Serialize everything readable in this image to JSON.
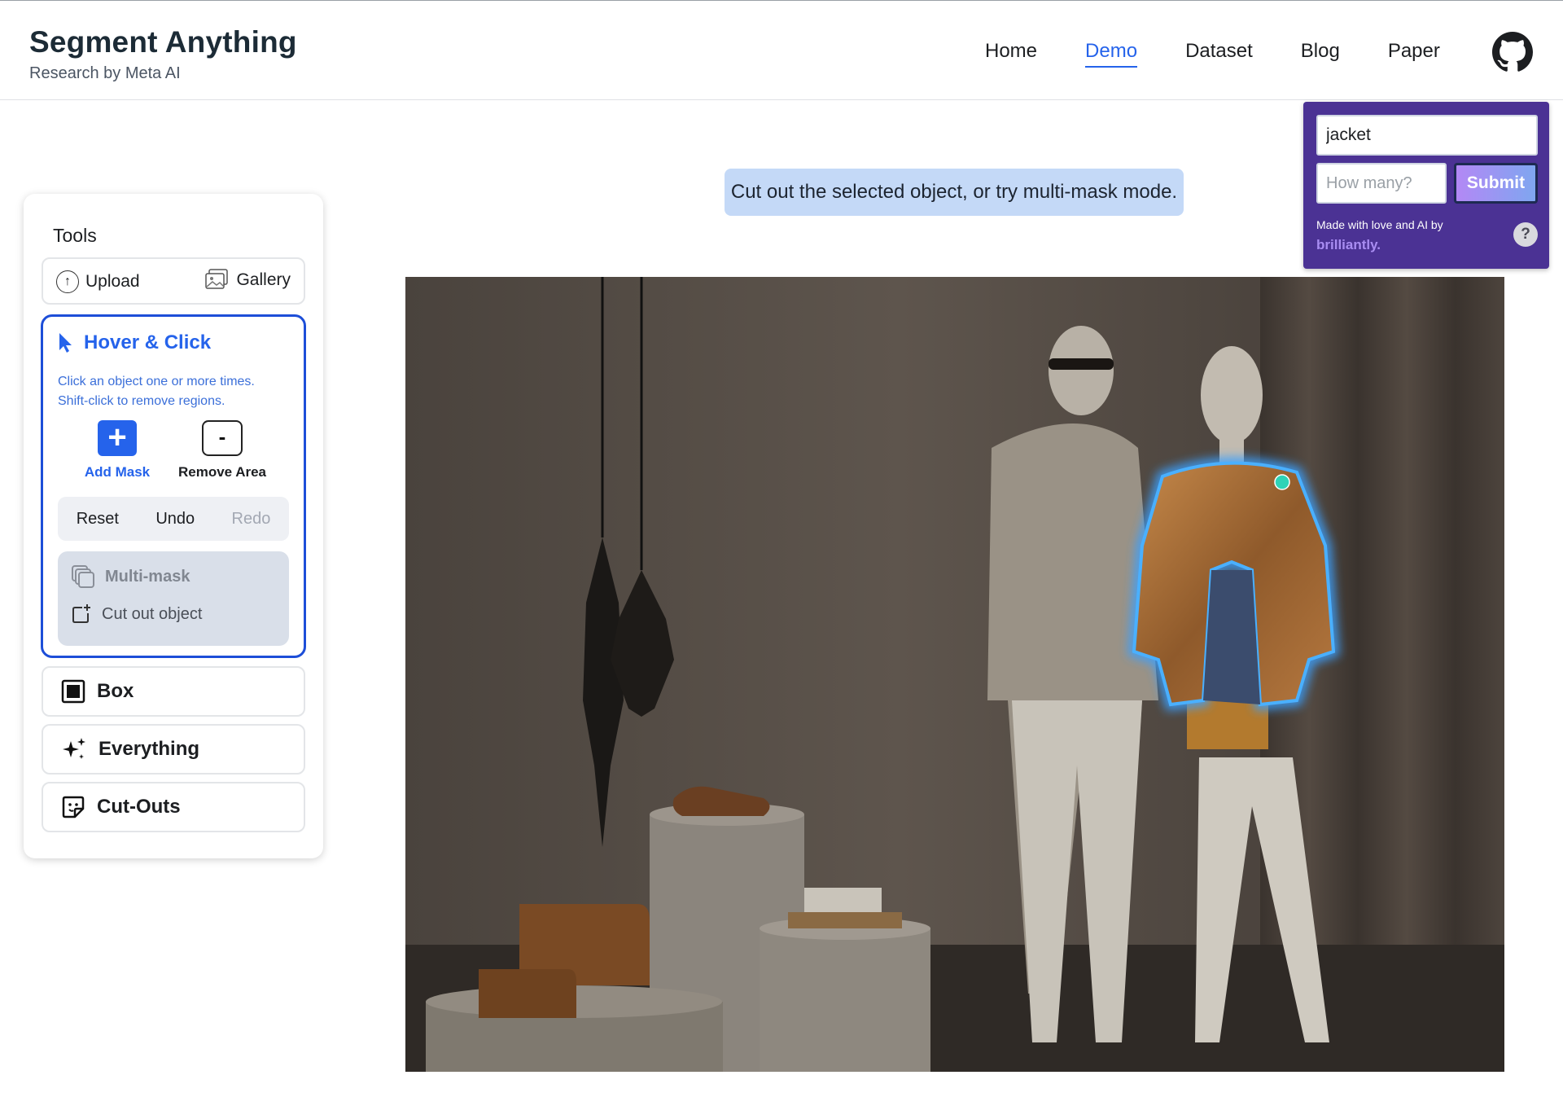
{
  "header": {
    "title": "Segment Anything",
    "subtitle": "Research by Meta AI",
    "nav": [
      {
        "label": "Home",
        "active": false
      },
      {
        "label": "Demo",
        "active": true
      },
      {
        "label": "Dataset",
        "active": false
      },
      {
        "label": "Blog",
        "active": false
      },
      {
        "label": "Paper",
        "active": false
      }
    ],
    "github_icon": "github-icon"
  },
  "ai_panel": {
    "query_value": "jacket",
    "count_placeholder": "How many?",
    "submit_label": "Submit",
    "credit": "Made with love and AI by",
    "brand": "brilliantly.",
    "help": "?"
  },
  "hint": "Cut out the selected object, or try multi-mask mode.",
  "tools": {
    "title": "Tools",
    "upload": "Upload",
    "gallery": "Gallery",
    "hover_click": {
      "title": "Hover & Click",
      "desc_line1": "Click an object one or more times.",
      "desc_line2": "Shift-click to remove regions.",
      "add_mask": "Add Mask",
      "remove_area": "Remove Area",
      "reset": "Reset",
      "undo": "Undo",
      "redo": "Redo",
      "multi_mask": "Multi-mask",
      "cut_out": "Cut out object"
    },
    "box": "Box",
    "everything": "Everything",
    "cutouts": "Cut-Outs"
  },
  "colors": {
    "accent": "#2563eb",
    "panel": "#4b3294",
    "hint_bg": "#c4d9f7",
    "mask_outline": "#3aa0ff",
    "click_point": "#2ed3b7"
  }
}
